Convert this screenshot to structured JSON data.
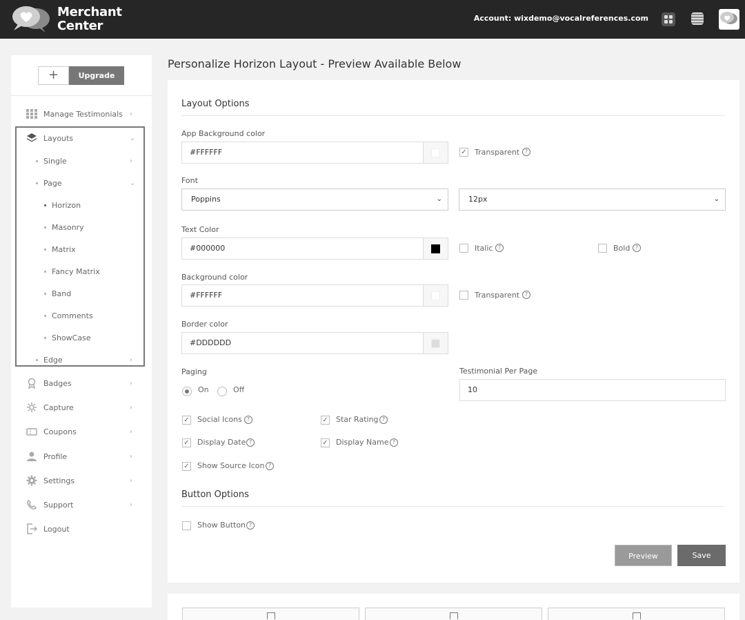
{
  "header": {
    "brand_line1": "Merchant",
    "brand_line2": "Center",
    "account_text": "Account: wixdemo@vocalreferences.com"
  },
  "sidebar": {
    "plus_label": "+",
    "upgrade_label": "Upgrade",
    "items": [
      {
        "label": "Manage Testimonials",
        "icon": "grid-icon"
      },
      {
        "label": "Layouts",
        "icon": "layers-icon"
      },
      {
        "label": "Badges",
        "icon": "badge-icon"
      },
      {
        "label": "Capture",
        "icon": "capture-icon"
      },
      {
        "label": "Coupons",
        "icon": "coupon-icon"
      },
      {
        "label": "Profile",
        "icon": "user-icon"
      },
      {
        "label": "Settings",
        "icon": "gear-icon"
      },
      {
        "label": "Support",
        "icon": "support-icon"
      },
      {
        "label": "Logout",
        "icon": "logout-icon"
      }
    ],
    "layouts_sub": [
      {
        "label": "Single"
      },
      {
        "label": "Page"
      },
      {
        "label": "Edge"
      }
    ],
    "page_sub": [
      {
        "label": "Horizon"
      },
      {
        "label": "Masonry"
      },
      {
        "label": "Matrix"
      },
      {
        "label": "Fancy Matrix"
      },
      {
        "label": "Band"
      },
      {
        "label": "Comments"
      },
      {
        "label": "ShowCase"
      }
    ]
  },
  "main": {
    "page_title": "Personalize Horizon Layout - Preview Available Below",
    "layout_options_title": "Layout Options",
    "app_bg": {
      "label": "App Background color",
      "value": "#FFFFFF",
      "swatch": "#FFFFFF",
      "transparent_label": "Transparent"
    },
    "font": {
      "label": "Font",
      "family": "Poppins",
      "size": "12px"
    },
    "text_color": {
      "label": "Text Color",
      "value": "#000000",
      "swatch": "#000000",
      "italic_label": "Italic",
      "bold_label": "Bold"
    },
    "bg_color": {
      "label": "Background color",
      "value": "#FFFFFF",
      "swatch": "#FFFFFF",
      "transparent_label": "Transparent"
    },
    "border_color": {
      "label": "Border color",
      "value": "#DDDDDD",
      "swatch": "#DDDDDD"
    },
    "paging": {
      "label": "Paging",
      "on_label": "On",
      "off_label": "Off"
    },
    "per_page": {
      "label": "Testimonial Per Page",
      "value": "10"
    },
    "checks": {
      "social_icons": "Social Icons",
      "star_rating": "Star Rating",
      "display_date": "Display Date",
      "display_name": "Display Name",
      "show_source_icon": "Show Source Icon"
    },
    "button_options_title": "Button Options",
    "show_button_label": "Show Button",
    "preview_label": "Preview",
    "save_label": "Save",
    "help_glyph": "?",
    "check_glyph": "✓",
    "caret_glyph": "⌄",
    "chevron_right": "›",
    "chevron_down": "⌄"
  }
}
